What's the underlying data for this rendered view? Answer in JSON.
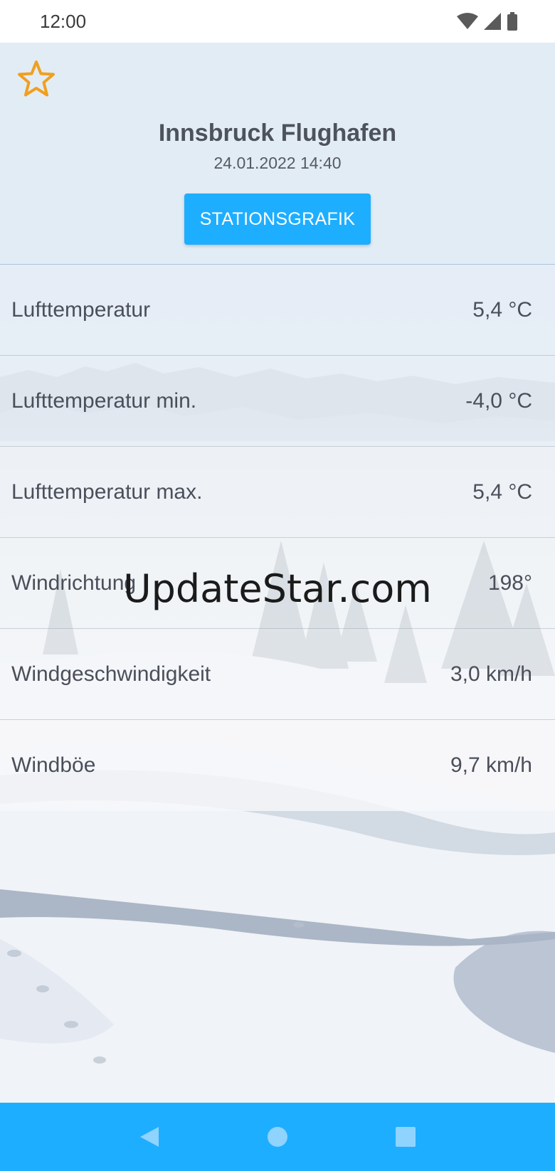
{
  "status_bar": {
    "time": "12:00",
    "icons": [
      "wifi-icon",
      "signal-icon",
      "battery-icon"
    ]
  },
  "header": {
    "favorite_icon": "star-outline-icon",
    "station_name": "Innsbruck Flughafen",
    "datetime": "24.01.2022 14:40",
    "graph_button_label": "STATIONSGRAFIK"
  },
  "measurements": [
    {
      "label": "Lufttemperatur",
      "value": "5,4 °C"
    },
    {
      "label": "Lufttemperatur min.",
      "value": "-4,0 °C"
    },
    {
      "label": "Lufttemperatur max.",
      "value": "5,4 °C"
    },
    {
      "label": "Windrichtung",
      "value": "198°"
    },
    {
      "label": "Windgeschwindigkeit",
      "value": "3,0 km/h"
    },
    {
      "label": "Windböe",
      "value": "9,7 km/h"
    }
  ],
  "watermark": "UpdateStar.com",
  "nav_bar": {
    "buttons": [
      "back-icon",
      "home-icon",
      "recents-icon"
    ]
  },
  "colors": {
    "accent": "#1eaeff",
    "star": "#f0a01e",
    "text": "#4a4f5a"
  }
}
